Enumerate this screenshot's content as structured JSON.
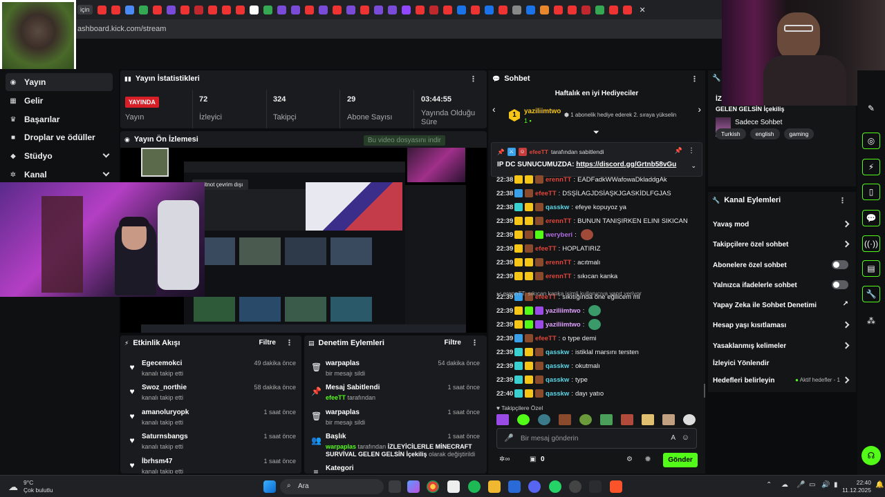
{
  "browser": {
    "url": "ashboard.kick.com/stream",
    "tab_label": "için"
  },
  "sidebar": {
    "items": [
      {
        "label": "Yayın",
        "icon": "broadcast-icon",
        "glyph": "((·))"
      },
      {
        "label": "Gelir",
        "icon": "money-icon",
        "glyph": "▦"
      },
      {
        "label": "Başarılar",
        "icon": "trophy-icon",
        "glyph": "🏆"
      },
      {
        "label": "Droplar ve ödüller",
        "icon": "gift-icon",
        "glyph": "🎁"
      },
      {
        "label": "Stüdyo",
        "icon": "studio-icon",
        "glyph": "⚙"
      },
      {
        "label": "Kanal",
        "icon": "channel-icon",
        "glyph": "⚙"
      }
    ]
  },
  "stats": {
    "title": "Yayın İstatistikleri",
    "live_badge": "YAYINDA",
    "live_label": "Yayın",
    "items": [
      {
        "value": "72",
        "label": "İzleyici"
      },
      {
        "value": "324",
        "label": "Takipçi"
      },
      {
        "value": "29",
        "label": "Abone Sayısı"
      },
      {
        "value": "03:44:55",
        "label": "Yayında Olduğu Süre"
      }
    ]
  },
  "preview": {
    "title": "Yayın Ön İzlemesi",
    "download_label": "Bu video dosyasını indir",
    "pip_label": "Zeitnot çevrim dışı"
  },
  "activity": {
    "title": "Etkinlik Akışı",
    "filter": "Filtre",
    "items": [
      {
        "name": "Egecemokci",
        "sub": "kanalı takip etti",
        "time": "49 dakika önce"
      },
      {
        "name": "Swoz_northie",
        "sub": "kanalı takip etti",
        "time": "58 dakika önce"
      },
      {
        "name": "amanoluryopk",
        "sub": "kanalı takip etti",
        "time": "1 saat önce"
      },
      {
        "name": "Saturnsbangs",
        "sub": "kanalı takip etti",
        "time": "1 saat önce"
      },
      {
        "name": "İbrhsm47",
        "sub": "kanalı takip etti",
        "time": "1 saat önce"
      }
    ]
  },
  "moderation": {
    "title": "Denetim Eylemleri",
    "filter": "Filtre",
    "items": [
      {
        "name": "warpaplas",
        "sub": "bir mesajı sildi",
        "time": "54 dakika önce",
        "icon": "trash-icon"
      },
      {
        "name": "Mesaj Sabitlendi",
        "sub_user": "efeeTT",
        "sub": "tarafından",
        "time": "1 saat önce",
        "icon": "pin-icon"
      },
      {
        "name": "warpaplas",
        "sub": "bir mesajı sildi",
        "time": "1 saat önce",
        "icon": "trash-icon"
      },
      {
        "name": "Başlık",
        "sub_user": "warpaplas",
        "sub": "tarafından",
        "sub_bold": "İZLEYİCİLERLE MİNECRAFT SURVİVAL GELEN GELSİN İçekiliş",
        "sub_end": "olarak değiştirildi",
        "time": "1 saat önce",
        "icon": "users-icon"
      },
      {
        "name": "Kategori",
        "sub": "",
        "time": "",
        "icon": "list-icon"
      }
    ]
  },
  "chat": {
    "title": "Sohbet",
    "gifters_title": "Haftalık en iyi Hediyeciler",
    "top_gifter": "yaziliimtwo",
    "top_gifter_count": "1",
    "gifter_hint": "1 abonelik hediye ederek 2. sıraya yükselin",
    "pinned_by": "efeeTT",
    "pinned_by_suffix": "tarafından sabitlendi",
    "pinned_text": "IP DC SUNUCUMUZDA:",
    "pinned_link": "https://discord.gg/Grtnb58vGu",
    "messages": [
      {
        "time": "22:38",
        "user": "erennTT",
        "color": "#e0453a",
        "text": "EADFadkWWafowaDkladdgAk"
      },
      {
        "time": "22:38",
        "user": "efeeTT",
        "color": "#e0453a",
        "text": "DSŞİLAGJDSİAŞKJGASKİDLFGJAS"
      },
      {
        "time": "22:38",
        "user": "qasskw",
        "color": "#5ad6e6",
        "text": "efeye kopuyoz ya"
      },
      {
        "time": "22:39",
        "user": "erennTT",
        "color": "#e0453a",
        "text": "BUNUN TANIŞIRKEN ELINI SIKICAN"
      },
      {
        "time": "22:39",
        "user": "weryberi",
        "color": "#b06be0",
        "text": ""
      },
      {
        "time": "22:39",
        "user": "efeeTT",
        "color": "#e0453a",
        "text": "HOPLATIRIZ"
      },
      {
        "time": "22:39",
        "user": "erennTT",
        "color": "#e0453a",
        "text": "acıtmalı"
      },
      {
        "time": "22:39",
        "user": "erennTT",
        "color": "#e0453a",
        "text": "sıkıcan kanka"
      },
      {
        "time": "22:39",
        "user": "efeeTT",
        "color": "#e0453a",
        "text": "sıkıtığında öne eğilicem mi"
      },
      {
        "time": "22:39",
        "user": "yaziliimtwo",
        "color": "#e0a0ff",
        "text": ""
      },
      {
        "time": "22:39",
        "user": "yaziliimtwo",
        "color": "#e0a0ff",
        "text": ""
      },
      {
        "time": "22:39",
        "user": "efeeTT",
        "color": "#e0453a",
        "text": "o type demi"
      },
      {
        "time": "22:39",
        "user": "qasskw",
        "color": "#5ad6e6",
        "text": "istiklal marsını tersten"
      },
      {
        "time": "22:39",
        "user": "qasskw",
        "color": "#5ad6e6",
        "text": "okutmalı"
      },
      {
        "time": "22:39",
        "user": "qasskw",
        "color": "#5ad6e6",
        "text": "type"
      },
      {
        "time": "22:40",
        "user": "qasskw",
        "color": "#5ad6e6",
        "text": "dayı yatıo"
      }
    ],
    "reply_note": "erennTT: sıkıcan kanka isimli kullanıcıya yanıt veriyor",
    "emote_label": "Takipçilere Özel",
    "input_placeholder": "Bir mesaj gönderin",
    "points": "0",
    "send_label": "Gönder"
  },
  "channel": {
    "title_fragment": "İZ",
    "title_line": "GELEN GELSİN İçekiliş",
    "mode": "Sadece Sohbet",
    "tags": [
      "Turkish",
      "english",
      "gaming"
    ]
  },
  "actions": {
    "title": "Kanal Eylemleri",
    "items": [
      {
        "label": "Yavaş mod",
        "kind": "chevron"
      },
      {
        "label": "Takipçilere özel sohbet",
        "kind": "chevron"
      },
      {
        "label": "Abonelere özel sohbet",
        "kind": "toggle"
      },
      {
        "label": "Yalnızca ifadelerle sohbet",
        "kind": "toggle"
      },
      {
        "label": "Yapay Zeka ile Sohbet Denetimi",
        "kind": "external"
      },
      {
        "label": "Hesap yaşı kısıtlaması",
        "kind": "chevron"
      },
      {
        "label": "Yasaklanmış kelimeler",
        "kind": "chevron"
      },
      {
        "label": "İzleyici Yönlendir",
        "kind": "none"
      },
      {
        "label": "Hedefleri belirleyin",
        "kind": "chevron",
        "extra": "Aktif hedefler - 1"
      }
    ]
  },
  "taskbar": {
    "weather_temp": "9°C",
    "weather_text": "Çok bulutlu",
    "search_label": "Ara",
    "time": "22:40",
    "date": "11.12.2025"
  },
  "colors": {
    "accent": "#53fc18",
    "live": "#d61f27",
    "panel": "#191b1e",
    "bg": "#0b0c0d"
  }
}
